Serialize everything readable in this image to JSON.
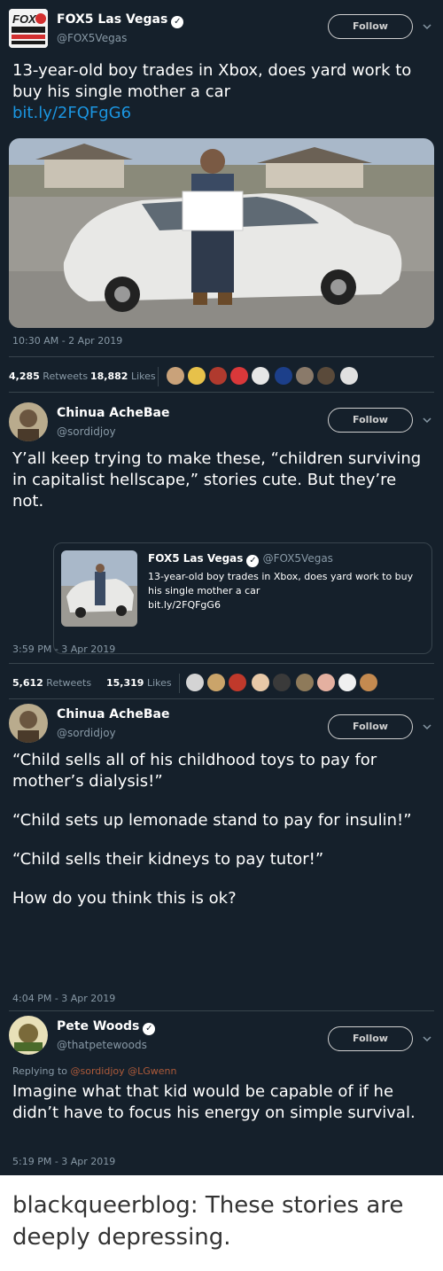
{
  "tweets": [
    {
      "name": "FOX5 Las Vegas",
      "handle": "@FOX5Vegas",
      "avatar_text": "FOX5",
      "follow_label": "Follow",
      "text": "13-year-old boy trades in Xbox, does yard work to buy his single mother a car",
      "link": "bit.ly/2FQFgG6",
      "time": "10:30 AM - 2 Apr 2019",
      "retweets": "4,285",
      "retweets_label": "Retweets",
      "likes": "18,882",
      "likes_label": "Likes"
    },
    {
      "name": "Chinua AcheBae",
      "handle": "@sordidjoy",
      "follow_label": "Follow",
      "text": "Y’all keep trying to make these, “children surviving in capitalist hellscape,” stories cute. But they’re not.",
      "quote": {
        "name": "FOX5 Las Vegas",
        "handle": "@FOX5Vegas",
        "text": "13-year-old boy trades in Xbox, does yard work to buy his single mother a car",
        "link": "bit.ly/2FQFgG6"
      },
      "time": "3:59 PM - 3 Apr 2019",
      "retweets": "5,612",
      "retweets_label": "Retweets",
      "likes": "15,319",
      "likes_label": "Likes"
    },
    {
      "name": "Chinua AcheBae",
      "handle": "@sordidjoy",
      "follow_label": "Follow",
      "paragraphs": [
        "“Child sells all of his childhood toys to pay for mother’s dialysis!”",
        "“Child sets up lemonade stand to pay for insulin!”",
        "“Child sells their kidneys to pay tutor!”",
        "How do you think this is ok?"
      ],
      "time": "4:04 PM - 3 Apr 2019"
    },
    {
      "name": "Pete Woods",
      "handle": "@thatpetewoods",
      "follow_label": "Follow",
      "replying_prefix": "Replying to",
      "replying_to": "@sordidjoy @LGwenn",
      "text": "Imagine what that kid would be capable of if he didn’t have to focus his energy on simple survival.",
      "time": "5:19 PM - 3 Apr 2019"
    }
  ],
  "caption": "blackqueerblog: These stories are deeply depressing.",
  "colors": {
    "background": "#15202b",
    "link": "#1b95e0",
    "muted": "#8899a6",
    "divider": "#38444d"
  },
  "icons": [
    "verified-badge-icon",
    "chevron-down-icon"
  ]
}
